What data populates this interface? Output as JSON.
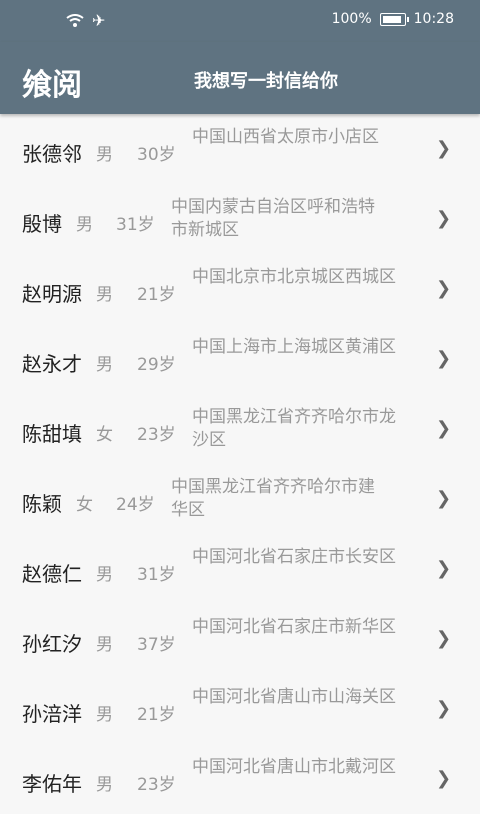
{
  "status": {
    "battery": "100%",
    "battery_level": 1.0,
    "time": "10:28"
  },
  "app": {
    "title": "飨阅",
    "subtitle": "我想写一封信给你"
  },
  "people": [
    {
      "name": "张德邻",
      "gender": "男",
      "age": "30岁",
      "address": "中国山西省太原市小店区"
    },
    {
      "name": "殷博",
      "gender": "男",
      "age": "31岁",
      "address": "中国内蒙古自治区呼和浩特市新城区"
    },
    {
      "name": "赵明源",
      "gender": "男",
      "age": "21岁",
      "address": "中国北京市北京城区西城区"
    },
    {
      "name": "赵永才",
      "gender": "男",
      "age": "29岁",
      "address": "中国上海市上海城区黄浦区"
    },
    {
      "name": "陈甜填",
      "gender": "女",
      "age": "23岁",
      "address": "中国黑龙江省齐齐哈尔市龙沙区"
    },
    {
      "name": "陈颖",
      "gender": "女",
      "age": "24岁",
      "address": "中国黑龙江省齐齐哈尔市建华区"
    },
    {
      "name": "赵德仁",
      "gender": "男",
      "age": "31岁",
      "address": "中国河北省石家庄市长安区"
    },
    {
      "name": "孙红汐",
      "gender": "男",
      "age": "37岁",
      "address": "中国河北省石家庄市新华区"
    },
    {
      "name": "孙涪洋",
      "gender": "男",
      "age": "21岁",
      "address": "中国河北省唐山市山海关区"
    },
    {
      "name": "李佑年",
      "gender": "男",
      "age": "23岁",
      "address": "中国河北省唐山市北戴河区"
    }
  ]
}
